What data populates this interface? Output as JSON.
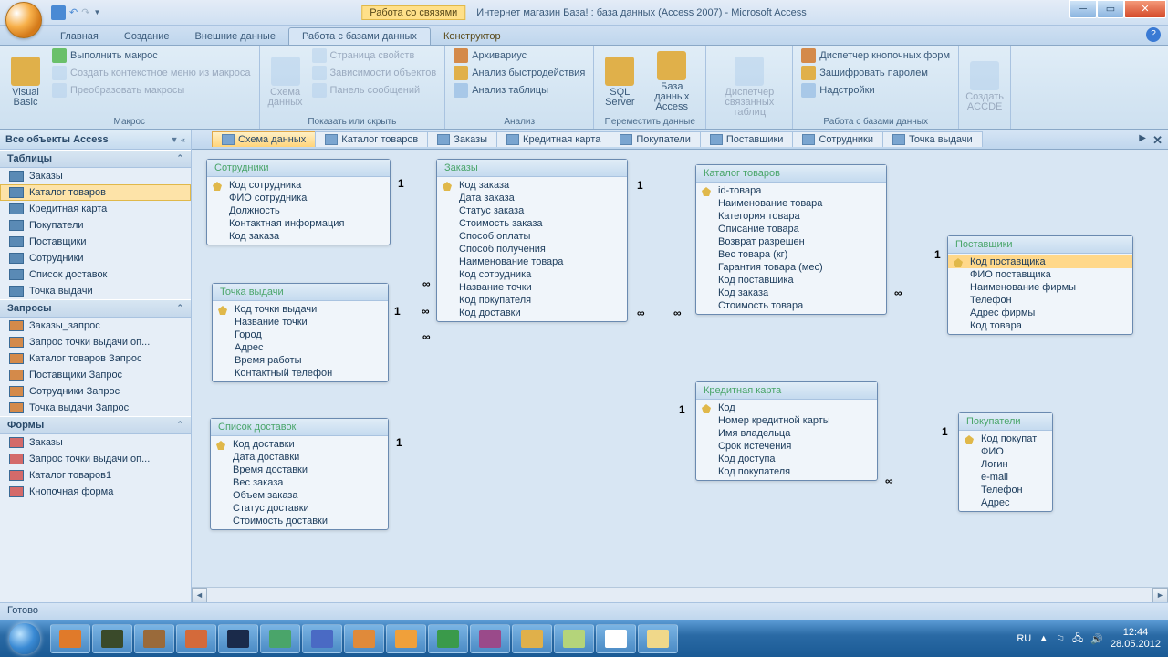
{
  "window": {
    "context_title": "Работа со связями",
    "title": "Интернет магазин База! : база данных (Access 2007) - Microsoft Access"
  },
  "ribbon_tabs": {
    "items": [
      "Главная",
      "Создание",
      "Внешние данные",
      "Работа с базами данных",
      "Конструктор"
    ],
    "active": "Работа с базами данных"
  },
  "ribbon": {
    "g0": {
      "label": "Макрос",
      "big": "Visual\nBasic",
      "s0": "Выполнить макрос",
      "s1": "Создать контекстное меню из макроса",
      "s2": "Преобразовать макросы"
    },
    "g1": {
      "label": "Показать или скрыть",
      "big": "Схема\nданных",
      "s0": "Страница свойств",
      "s1": "Зависимости объектов",
      "s2": "Панель сообщений"
    },
    "g2": {
      "label": "Анализ",
      "s0": "Архивариус",
      "s1": "Анализ быстродействия",
      "s2": "Анализ таблицы"
    },
    "g3": {
      "label": "Переместить данные",
      "b0": "SQL\nServer",
      "b1": "База данных\nAccess"
    },
    "g4": {
      "label": " ",
      "big": "Диспетчер\nсвязанных таблиц"
    },
    "g5": {
      "label": "Работа с базами данных",
      "s0": "Диспетчер кнопочных форм",
      "s1": "Зашифровать паролем",
      "s2": "Надстройки"
    },
    "g6": {
      "label": " ",
      "big": "Создать\nACCDE"
    }
  },
  "nav": {
    "header": "Все объекты Access",
    "cat_tables": "Таблицы",
    "tables": [
      "Заказы",
      "Каталог товаров",
      "Кредитная карта",
      "Покупатели",
      "Поставщики",
      "Сотрудники",
      "Список доставок",
      "Точка выдачи"
    ],
    "sel_table": "Каталог товаров",
    "cat_queries": "Запросы",
    "queries": [
      "Заказы_запрос",
      "Запрос точки выдачи оп...",
      "Каталог товаров Запрос",
      "Поставщики Запрос",
      "Сотрудники Запрос",
      "Точка выдачи Запрос"
    ],
    "cat_forms": "Формы",
    "forms": [
      "Заказы",
      "Запрос точки выдачи оп...",
      "Каталог товаров1",
      "Кнопочная форма"
    ]
  },
  "doc_tabs": {
    "items": [
      "Схема данных",
      "Каталог товаров",
      "Заказы",
      "Кредитная карта",
      "Покупатели",
      "Поставщики",
      "Сотрудники",
      "Точка выдачи"
    ],
    "active": "Схема данных"
  },
  "entities": {
    "e0": {
      "title": "Сотрудники",
      "pk": "Код сотрудника",
      "f": [
        "ФИО сотрудника",
        "Должность",
        "Контактная информация",
        "Код заказа"
      ]
    },
    "e1": {
      "title": "Точка выдачи",
      "pk": "Код точки выдачи",
      "f": [
        "Название точки",
        "Город",
        "Адрес",
        "Время работы",
        "Контактный телефон"
      ]
    },
    "e2": {
      "title": "Список доставок",
      "pk": "Код доставки",
      "f": [
        "Дата доставки",
        "Время доставки",
        "Вес заказа",
        "Объем заказа",
        "Статус доставки",
        "Стоимость доставки"
      ]
    },
    "e3": {
      "title": "Заказы",
      "pk": "Код заказа",
      "f": [
        "Дата заказа",
        "Статус заказа",
        "Стоимость заказа",
        "Способ оплаты",
        "Способ получения",
        "Наименование товара",
        "Код сотрудника",
        "Название точки",
        "Код покупателя",
        "Код доставки"
      ]
    },
    "e4": {
      "title": "Каталог товаров",
      "pk": "id-товара",
      "f": [
        "Наименование товара",
        "Категория товара",
        "Описание товара",
        "Возврат разрешен",
        "Вес товара (кг)",
        "Гарантия товара (мес)",
        "Код поставщика",
        "Код заказа",
        "Стоимость товара"
      ]
    },
    "e5": {
      "title": "Кредитная карта",
      "pk": "Код",
      "f": [
        "Номер кредитной карты",
        "Имя владельца",
        "Срок истечения",
        "Код доступа",
        "Код покупателя"
      ]
    },
    "e6": {
      "title": "Поставщики",
      "pk": "Код поставщика",
      "f": [
        "ФИО поставщика",
        "Наименование фирмы",
        "Телефон",
        "Адрес фирмы",
        "Код товара"
      ]
    },
    "e7": {
      "title": "Покупатели",
      "pk": "Код покупат",
      "f": [
        "ФИО",
        "Логин",
        "e-mail",
        "Телефон",
        "Адрес"
      ]
    }
  },
  "status": "Готово",
  "tray": {
    "lang": "RU",
    "time": "12:44",
    "date": "28.05.2012"
  }
}
